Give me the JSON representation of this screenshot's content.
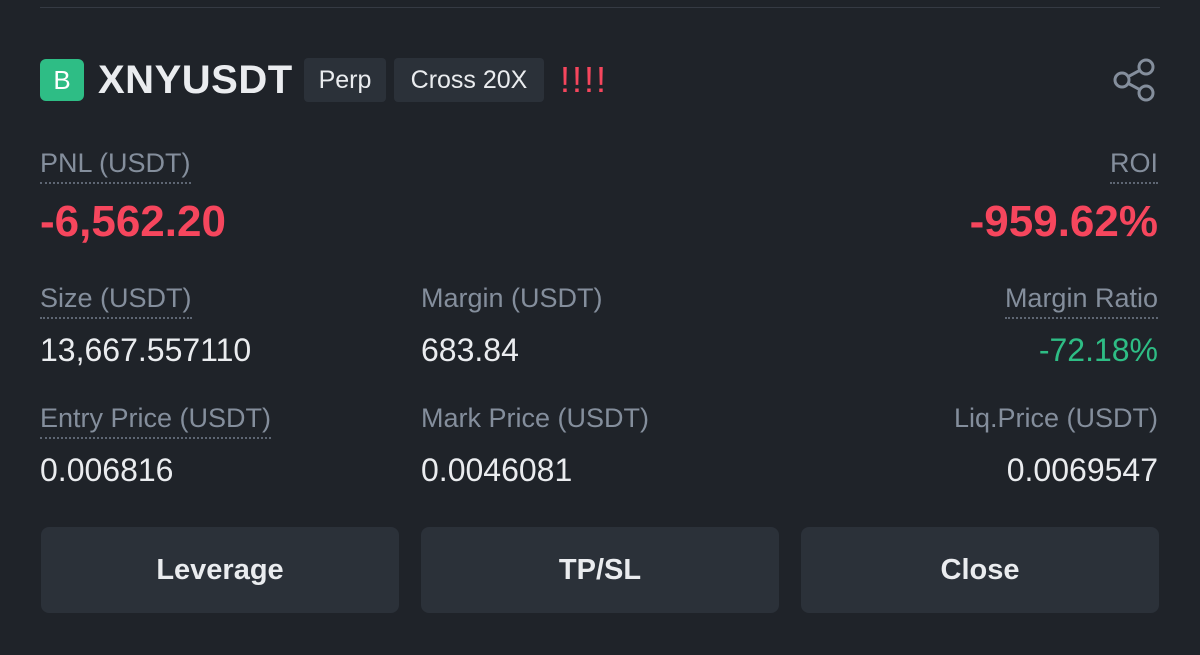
{
  "position": {
    "side_badge": "B",
    "symbol": "XNYUSDT",
    "contract_type": "Perp",
    "margin_mode": "Cross 20X",
    "warning": "!!!!"
  },
  "pnl": {
    "label": "PNL (USDT)",
    "value": "-6,562.20"
  },
  "roi": {
    "label": "ROI",
    "value": "-959.62%"
  },
  "size": {
    "label": "Size (USDT)",
    "value": "13,667.557110"
  },
  "margin": {
    "label": "Margin (USDT)",
    "value": "683.84"
  },
  "margin_ratio": {
    "label": "Margin Ratio",
    "value": "-72.18%"
  },
  "entry_price": {
    "label": "Entry Price (USDT)",
    "value": "0.006816"
  },
  "mark_price": {
    "label": "Mark Price (USDT)",
    "value": "0.0046081"
  },
  "liq_price": {
    "label": "Liq.Price (USDT)",
    "value": "0.0069547"
  },
  "actions": {
    "leverage": "Leverage",
    "tpsl": "TP/SL",
    "close": "Close"
  },
  "icons": {
    "share": "share-icon"
  },
  "colors": {
    "background": "#1f2329",
    "loss": "#f6465d",
    "profit_green": "#2ebd85",
    "muted": "#848e9c",
    "button_bg": "#2b3139"
  }
}
